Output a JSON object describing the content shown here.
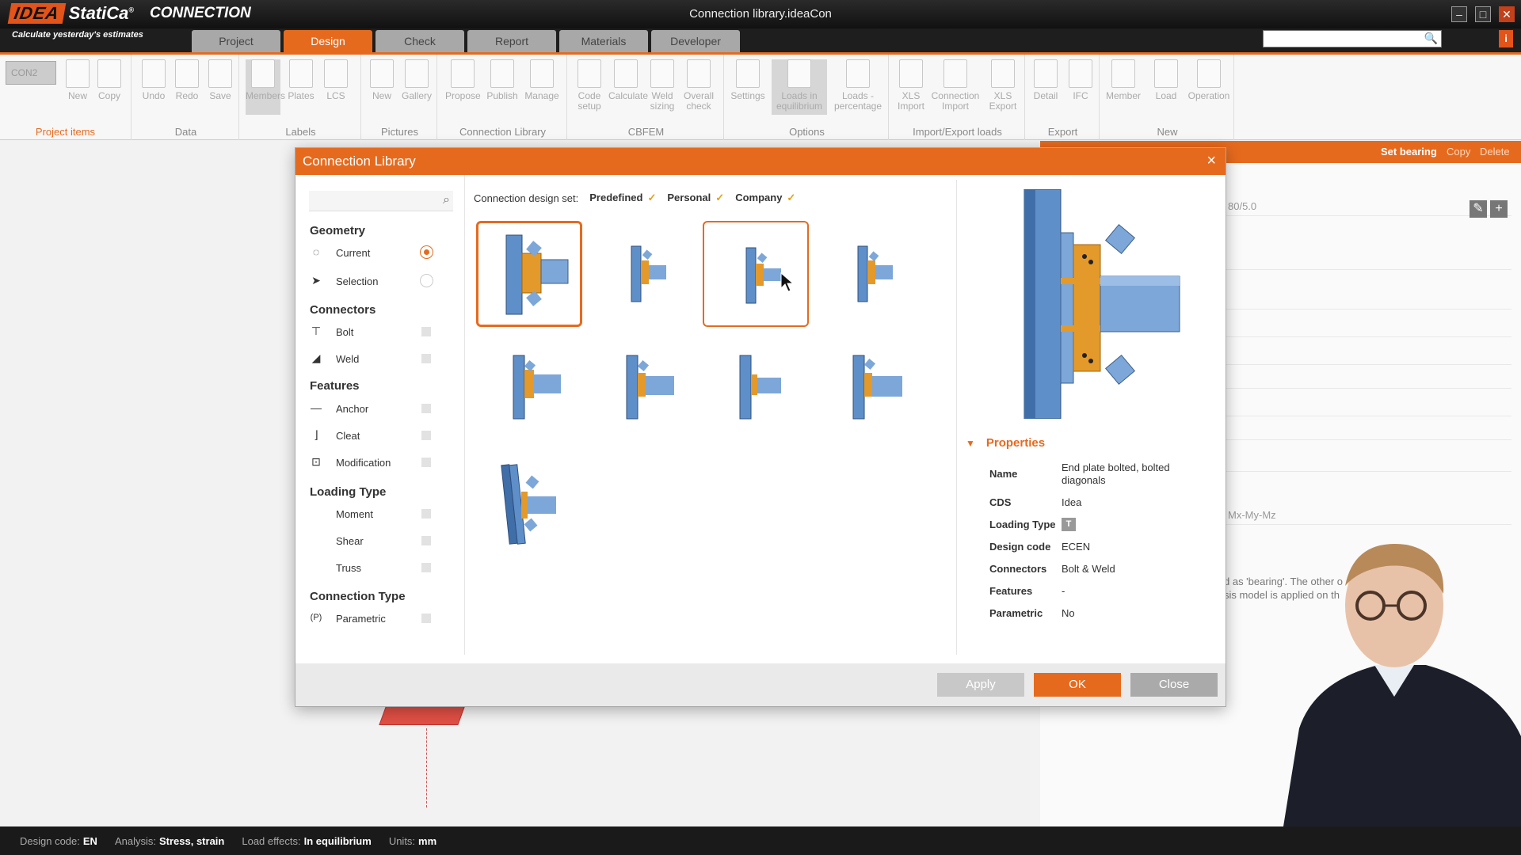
{
  "app": {
    "brand": "IDEA StatiCa",
    "product": "CONNECTION",
    "tagline": "Calculate yesterday's estimates",
    "window_title": "Connection library.ideaCon"
  },
  "tabs": [
    "Project",
    "Design",
    "Check",
    "Report",
    "Materials",
    "Developer"
  ],
  "active_tab": "Design",
  "ribbon": {
    "con_selector": "CON2",
    "groups": [
      {
        "label": "Project items",
        "buttons": [
          "New",
          "Copy"
        ]
      },
      {
        "label": "Data",
        "buttons": [
          "Undo",
          "Redo",
          "Save"
        ]
      },
      {
        "label": "Labels",
        "buttons": [
          "Members",
          "Plates",
          "LCS"
        ]
      },
      {
        "label": "Pictures",
        "buttons": [
          "New",
          "Gallery"
        ]
      },
      {
        "label": "Connection Library",
        "buttons": [
          "Propose",
          "Publish",
          "Manage"
        ]
      },
      {
        "label": "CBFEM",
        "buttons": [
          "Code setup",
          "Calculate",
          "Weld sizing",
          "Overall check"
        ]
      },
      {
        "label": "Options",
        "buttons": [
          "Settings",
          "Loads in equilibrium",
          "Loads - percentage"
        ]
      },
      {
        "label": "Import/Export loads",
        "buttons": [
          "XLS Import",
          "Connection Import",
          "XLS Export"
        ]
      },
      {
        "label": "Export",
        "buttons": [
          "Detail",
          "IFC"
        ]
      },
      {
        "label": "New",
        "buttons": [
          "Member",
          "Load",
          "Operation"
        ]
      }
    ]
  },
  "right_panel": {
    "actions": [
      "Set bearing",
      "Copy",
      "Delete"
    ],
    "field_1": "80/5.0",
    "field_2": "Mx-My-Mz",
    "note_line1": "d as 'bearing'. The other o",
    "note_line2": "sis model is applied on th"
  },
  "dialog": {
    "title": "Connection Library",
    "cds_label": "Connection design set:",
    "cds_sets": [
      "Predefined",
      "Personal",
      "Company"
    ],
    "filters": {
      "geometry_title": "Geometry",
      "geometry": [
        "Current",
        "Selection"
      ],
      "geometry_selected": "Current",
      "connectors_title": "Connectors",
      "connectors": [
        "Bolt",
        "Weld"
      ],
      "features_title": "Features",
      "features": [
        "Anchor",
        "Cleat",
        "Modification"
      ],
      "loading_title": "Loading Type",
      "loading": [
        "Moment",
        "Shear",
        "Truss"
      ],
      "conn_type_title": "Connection Type",
      "conn_type": [
        "Parametric"
      ]
    },
    "properties": {
      "header": "Properties",
      "name_label": "Name",
      "name": "End plate bolted, bolted diagonals",
      "cds_label": "CDS",
      "cds": "Idea",
      "loading_type_label": "Loading Type",
      "loading_type_icon": "T",
      "design_code_label": "Design code",
      "design_code": "ECEN",
      "connectors_label": "Connectors",
      "connectors": "Bolt & Weld",
      "features_label": "Features",
      "features": "-",
      "parametric_label": "Parametric",
      "parametric": "No"
    },
    "buttons": {
      "apply": "Apply",
      "ok": "OK",
      "close": "Close"
    }
  },
  "status": {
    "design_code_label": "Design code:",
    "design_code": "EN",
    "analysis_label": "Analysis:",
    "analysis": "Stress, strain",
    "load_label": "Load effects:",
    "load": "In equilibrium",
    "units_label": "Units:",
    "units": "mm"
  }
}
